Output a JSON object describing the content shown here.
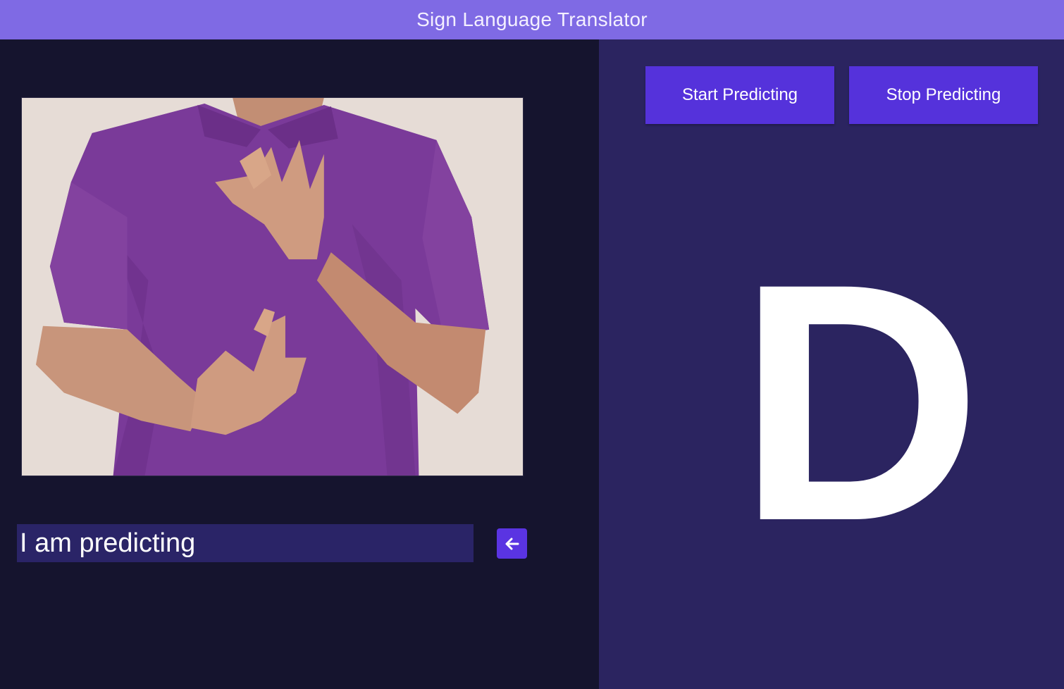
{
  "window": {
    "title": "Sign Language Translator"
  },
  "controls": {
    "start_label": "Start Predicting",
    "stop_label": "Stop Predicting"
  },
  "output": {
    "sentence": "I am predicting",
    "predicted_letter": "D"
  },
  "icons": {
    "backspace": "arrow-left-icon"
  },
  "colors": {
    "title_bar": "#7f6ae4",
    "left_panel": "#15142e",
    "right_panel": "#2b2460",
    "button": "#5532db",
    "text_field": "#2a2467"
  }
}
